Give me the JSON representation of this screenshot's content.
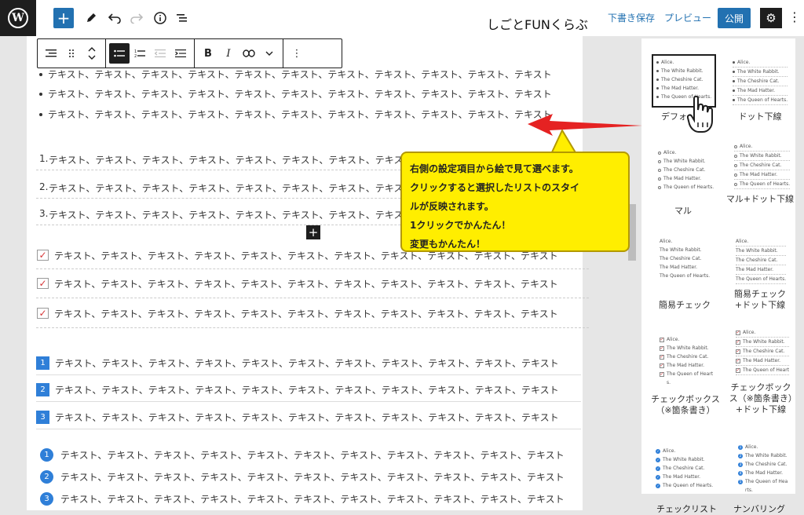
{
  "topbar": {
    "logo_icon": "wordpress-logo-icon",
    "site_title": "しごとFUNくらぶ",
    "save_draft": "下書き保存",
    "preview": "プレビュー",
    "publish": "公開"
  },
  "toolbar": {
    "icons": [
      "list-icon",
      "drag-handle-icon",
      "move-up-down-icon",
      "bulleted-list-icon",
      "numbered-list-icon",
      "outdent-icon",
      "indent-icon",
      "bold-icon",
      "italic-icon",
      "link-icon",
      "chevron-down-icon",
      "more-options-icon"
    ],
    "bold": "B",
    "italic": "I"
  },
  "content": {
    "item_text": "テキスト、テキスト、テキスト、テキスト、テキスト、テキスト、テキスト、テキスト、テキスト、テキスト、テキスト",
    "numbered_prefix": [
      "1.",
      "2.",
      "3."
    ],
    "square_numbers": [
      "1",
      "2",
      "3"
    ],
    "circle_numbers": [
      "1",
      "2",
      "3"
    ],
    "check_mark": "✓"
  },
  "callout": {
    "lines": [
      "右側の設定項目から絵で見て選べます。",
      "クリックすると選択したリストのスタイ",
      "ルが反映されます。",
      "1クリックでかんたん！",
      "変更もかんたん！"
    ],
    "color": "#ffee00",
    "arrow_color": "#e52222"
  },
  "sidebar": {
    "mini_items": [
      "Alice.",
      "The White Rabbit.",
      "The Cheshire Cat.",
      "The Mad Hatter.",
      "The Queen of Hearts."
    ],
    "mini_items_check": [
      "Alice.",
      "The White Rabbit.",
      "The Cheshire Cat.",
      "The Mad Hatter.",
      "The Queen of Heart"
    ],
    "mini_check_tail": "s.",
    "styles": [
      {
        "label": "デフォ"
      },
      {
        "label": "ドット下線"
      },
      {
        "label": "マル"
      },
      {
        "label": "マル+ドット下線"
      },
      {
        "label": "簡易チェック"
      },
      {
        "label": "簡易チェック+ドット下線"
      },
      {
        "label": "チェックボックス（※箇条書き）"
      },
      {
        "label": "チェックボックス（※箇条書き）+ドット下線"
      }
    ],
    "bottom_labels": [
      "チェックリスト",
      "ナンバリング"
    ],
    "bottom_mini_check": [
      "Alice.",
      "The White Rabbit.",
      "The Cheshire Cat.",
      "The Mad Hatter.",
      "The Queen of Hearts."
    ],
    "bottom_mini_num": [
      "Alice.",
      "The White Rabbit.",
      "The Cheshire Cat.",
      "The Mad Hatter.",
      "The Queen of Hea"
    ],
    "bottom_mini_num_tail": "rts."
  },
  "colors": {
    "accent": "#2271b1",
    "number_badge": "#2f7fd8",
    "check": "#d63638"
  }
}
